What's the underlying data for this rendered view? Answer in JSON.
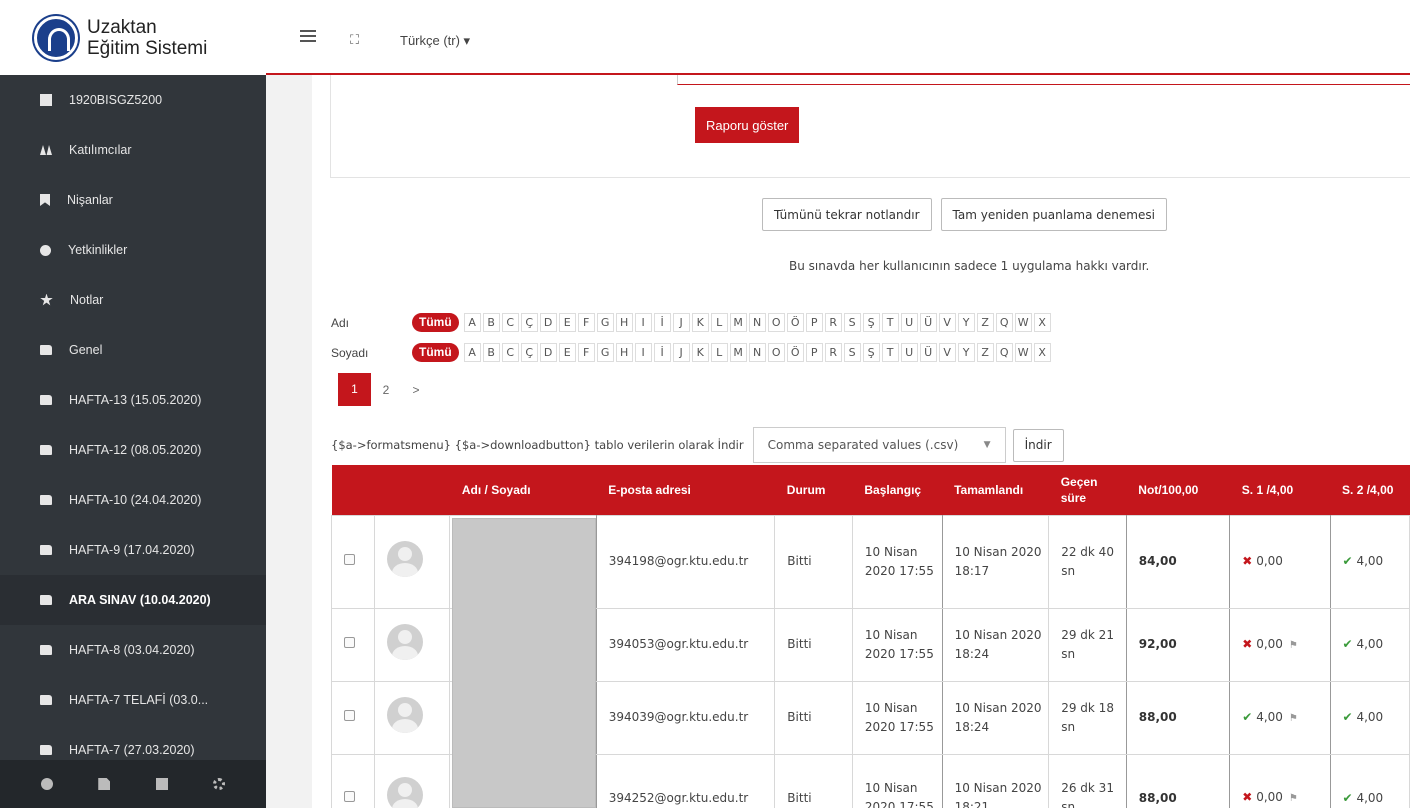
{
  "header": {
    "logo_line1": "Uzaktan",
    "logo_line2": "Eğitim Sistemi",
    "fullscreen_icon": "expand-icon",
    "language": "Türkçe (tr) ▾"
  },
  "sidebar": {
    "items": [
      {
        "label": "1920BISGZ5200",
        "icon": "book-icon"
      },
      {
        "label": "Katılımcılar",
        "icon": "users-icon"
      },
      {
        "label": "Nişanlar",
        "icon": "bookmark-icon"
      },
      {
        "label": "Yetkinlikler",
        "icon": "check-circle-icon"
      },
      {
        "label": "Notlar",
        "icon": "star-icon"
      },
      {
        "label": "Genel",
        "icon": "folder-icon"
      },
      {
        "label": "HAFTA-13 (15.05.2020)",
        "icon": "folder-icon"
      },
      {
        "label": "HAFTA-12 (08.05.2020)",
        "icon": "folder-icon"
      },
      {
        "label": "HAFTA-10 (24.04.2020)",
        "icon": "folder-icon"
      },
      {
        "label": "HAFTA-9 (17.04.2020)",
        "icon": "folder-icon"
      },
      {
        "label": "ARA SINAV (10.04.2020)",
        "icon": "folder-icon",
        "active": true
      },
      {
        "label": "HAFTA-8 (03.04.2020)",
        "icon": "folder-icon"
      },
      {
        "label": "HAFTA-7 TELAFİ (03.0...",
        "icon": "folder-icon"
      },
      {
        "label": "HAFTA-7 (27.03.2020)",
        "icon": "folder-icon"
      }
    ],
    "footer_icons": [
      "chat-icon",
      "file-icon",
      "save-icon",
      "gear-icon"
    ]
  },
  "report": {
    "show_button": "Raporu göster",
    "regrade_all": "Tümünü tekrar notlandır",
    "dry_run": "Tam yeniden puanlama denemesi",
    "attempts_note": "Bu sınavda her kullanıcının sadece 1 uygulama hakkı vardır."
  },
  "filters": {
    "first_name_label": "Adı",
    "last_name_label": "Soyadı",
    "all_label": "Tümü",
    "letters": [
      "A",
      "B",
      "C",
      "Ç",
      "D",
      "E",
      "F",
      "G",
      "H",
      "I",
      "İ",
      "J",
      "K",
      "L",
      "M",
      "N",
      "O",
      "Ö",
      "P",
      "R",
      "S",
      "Ş",
      "T",
      "U",
      "Ü",
      "V",
      "Y",
      "Z",
      "Q",
      "W",
      "X"
    ]
  },
  "pagination": {
    "current": "1",
    "next_page": "2",
    "next_icon": "chevron-right-icon"
  },
  "download": {
    "label": "{$a->formatsmenu} {$a->downloadbutton} tablo verilerin olarak İndir",
    "format": "Comma separated values (.csv)",
    "button": "İndir"
  },
  "table": {
    "columns": [
      "",
      "",
      "Adı / Soyadı",
      "E-posta adresi",
      "Durum",
      "Başlangıç",
      "Tamamlandı",
      "Geçen süre",
      "Not/100,00",
      "S. 1 /4,00",
      "S. 2 /4,00"
    ],
    "rows": [
      {
        "email": "394198@ogr.ktu.edu.tr",
        "status": "Bitti",
        "start": "10 Nisan 2020 17:55",
        "finish": "10 Nisan 2020 18:17",
        "elapsed": "22 dk 40 sn",
        "grade": "84,00",
        "q1": "0,00",
        "q1_ok": false,
        "q1_flag": false,
        "q2": "4,00"
      },
      {
        "email": "394053@ogr.ktu.edu.tr",
        "status": "Bitti",
        "start": "10 Nisan 2020 17:55",
        "finish": "10 Nisan 2020 18:24",
        "elapsed": "29 dk 21 sn",
        "grade": "92,00",
        "q1": "0,00",
        "q1_ok": false,
        "q1_flag": true,
        "q2": "4,00"
      },
      {
        "email": "394039@ogr.ktu.edu.tr",
        "status": "Bitti",
        "start": "10 Nisan 2020 17:55",
        "finish": "10 Nisan 2020 18:24",
        "elapsed": "29 dk 18 sn",
        "grade": "88,00",
        "q1": "4,00",
        "q1_ok": true,
        "q1_flag": true,
        "q2": "4,00"
      },
      {
        "email": "394252@ogr.ktu.edu.tr",
        "status": "Bitti",
        "start": "10 Nisan 2020 17:55",
        "finish": "10 Nisan 2020 18:21",
        "elapsed": "26 dk 31 sn",
        "grade": "88,00",
        "q1": "0,00",
        "q1_ok": false,
        "q1_flag": true,
        "q2": "4,00"
      }
    ]
  },
  "colors": {
    "accent": "#c4161c",
    "sidebar": "#31363b",
    "ok": "#3a9a3a"
  }
}
